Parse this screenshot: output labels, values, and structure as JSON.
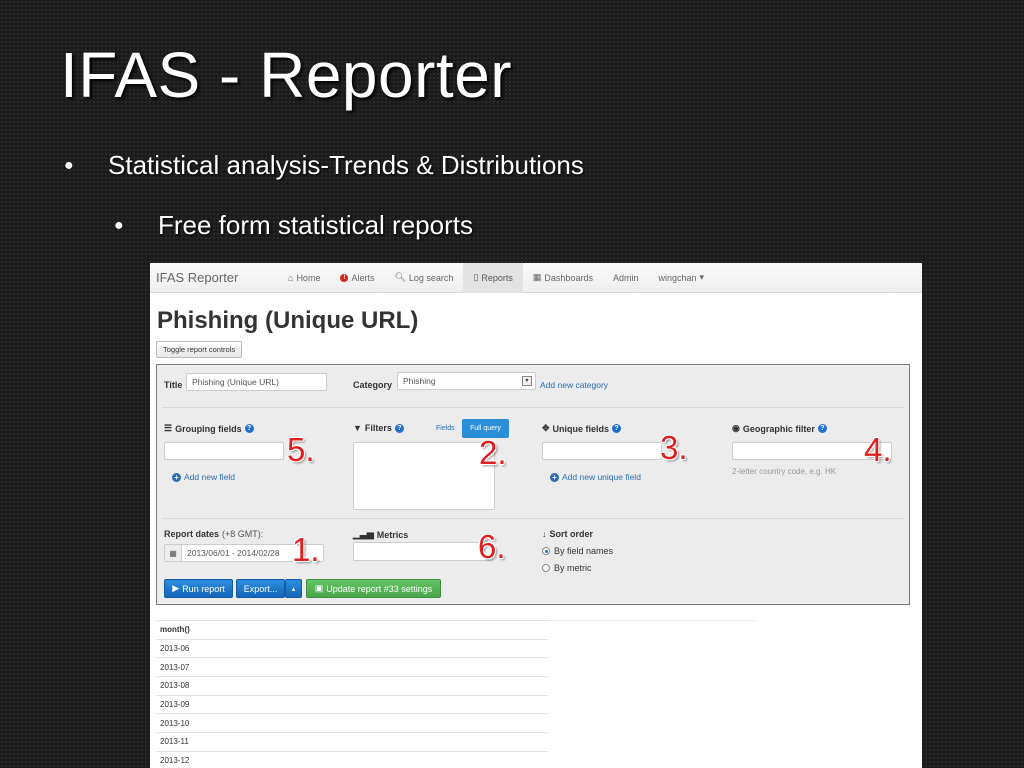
{
  "slide": {
    "title": "IFAS - Reporter",
    "bullets": [
      {
        "level": 1,
        "text": "Statistical analysis-Trends & Distributions"
      },
      {
        "level": 2,
        "text": "Free form statistical reports"
      }
    ]
  },
  "app": {
    "brand": "IFAS Reporter",
    "nav": [
      {
        "label": "Home",
        "icon": "home-icon",
        "active": false
      },
      {
        "label": "Alerts",
        "icon": "alert-icon",
        "active": false
      },
      {
        "label": "Log search",
        "icon": "search-icon",
        "active": false
      },
      {
        "label": "Reports",
        "icon": "document-icon",
        "active": true
      },
      {
        "label": "Dashboards",
        "icon": "grid-icon",
        "active": false
      },
      {
        "label": "Admin",
        "icon": "",
        "active": false
      },
      {
        "label": "wingchan",
        "icon": "caret-down-icon",
        "active": false
      }
    ],
    "page_title": "Phishing (Unique URL)",
    "toggle_label": "Toggle report controls",
    "form": {
      "title_label": "Title",
      "title_value": "Phishing (Unique URL)",
      "category_label": "Category",
      "category_value": "Phishing",
      "add_category": "Add new category",
      "grouping_label": "Grouping fields",
      "add_field": "Add new field",
      "filters_label": "Filters",
      "filters_tab_fields": "Fields",
      "filters_tab_full": "Full query",
      "unique_label": "Unique fields",
      "add_unique": "Add new unique field",
      "geo_label": "Geographic filter",
      "geo_hint": "2-letter country code, e.g. HK",
      "dates_label": "Report dates",
      "dates_tz": "(+8 GMT):",
      "dates_value": "2013/06/01 - 2014/02/28",
      "metrics_label": "Metrics",
      "sort_label": "Sort order",
      "sort_options": [
        "By field names",
        "By metric"
      ],
      "sort_selected": "By field names",
      "run_btn": "Run report",
      "export_btn": "Export...",
      "update_btn": "Update report #33 settings"
    },
    "annotations": [
      "1.",
      "2.",
      "3.",
      "4.",
      "5.",
      "6."
    ],
    "table": {
      "header": "month()",
      "rows": [
        "2013-06",
        "2013-07",
        "2013-08",
        "2013-09",
        "2013-10",
        "2013-11",
        "2013-12"
      ]
    }
  },
  "colors": {
    "primary": "#1f6fd1",
    "success": "#5cb85c",
    "annotation_red": "#e02020"
  }
}
